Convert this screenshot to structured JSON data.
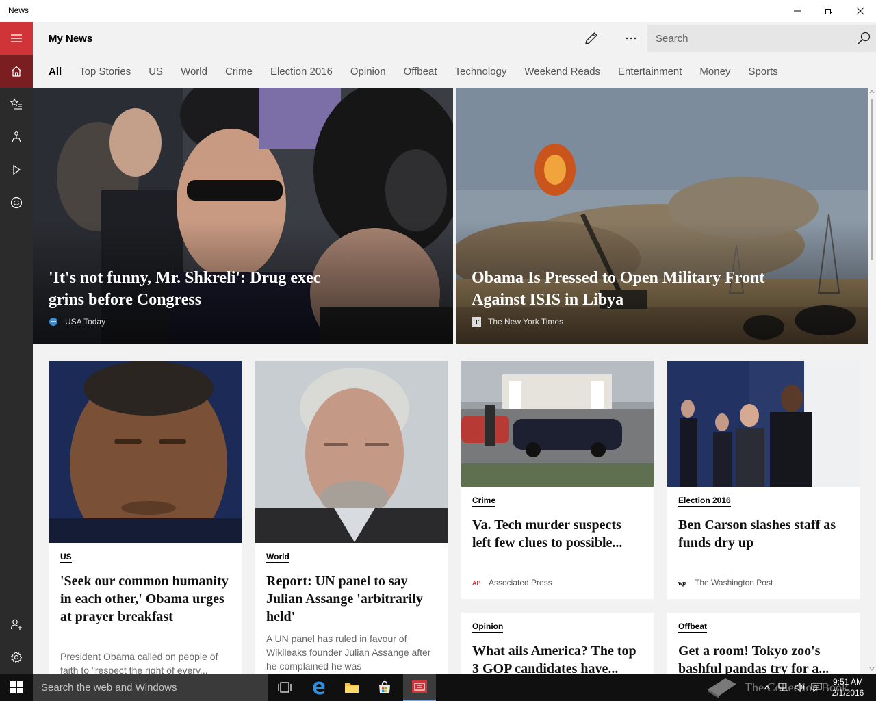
{
  "window": {
    "title": "News",
    "controls": [
      "minimize",
      "restore",
      "close"
    ]
  },
  "rail": {
    "items": [
      {
        "icon": "hamburger-icon",
        "name": "Menu"
      },
      {
        "icon": "home-icon",
        "name": "My News"
      },
      {
        "icon": "star-list-icon",
        "name": "Interests"
      },
      {
        "icon": "local-icon",
        "name": "Local"
      },
      {
        "icon": "play-icon",
        "name": "Video"
      },
      {
        "icon": "smiley-icon",
        "name": "Feedback"
      }
    ],
    "bottom": [
      {
        "icon": "add-person-icon",
        "name": "Sign in"
      },
      {
        "icon": "gear-icon",
        "name": "Settings"
      }
    ]
  },
  "header": {
    "title": "My News",
    "search_placeholder": "Search",
    "tabs": [
      "All",
      "Top Stories",
      "US",
      "World",
      "Crime",
      "Election 2016",
      "Opinion",
      "Offbeat",
      "Technology",
      "Weekend Reads",
      "Entertainment",
      "Money",
      "Sports"
    ],
    "active_tab": "All"
  },
  "hero": [
    {
      "title": "'It's not funny, Mr. Shkreli': Drug exec grins before Congress",
      "source": "USA Today"
    },
    {
      "title": "Obama Is Pressed to Open Military Front Against ISIS in Libya",
      "source": "The New York Times"
    }
  ],
  "cards": [
    {
      "category": "US",
      "title": "'Seek our common humanity in each other,' Obama urges at prayer breakfast",
      "summary": "President Obama called on people of faith to \"respect the right of every..."
    },
    {
      "category": "World",
      "title": "Report: UN panel to say Julian Assange 'arbitrarily held'",
      "summary": "A UN panel has ruled in favour of Wikileaks founder Julian Assange after he complained he was"
    },
    {
      "category": "Crime",
      "title": "Va. Tech murder suspects left few clues to possible...",
      "source": "Associated Press"
    },
    {
      "category": "Election 2016",
      "title": "Ben Carson slashes staff as funds dry up",
      "source": "The Washington Post"
    },
    {
      "category": "Opinion",
      "title": "What ails America? The top 3 GOP candidates have..."
    },
    {
      "category": "Offbeat",
      "title": "Get a room! Tokyo zoo's bashful pandas try for a..."
    }
  ],
  "taskbar": {
    "search_placeholder": "Search the web and Windows",
    "time": "9:51 AM",
    "date": "2/1/2016",
    "watermark": "The Collection Book",
    "apps": [
      "task-view-icon",
      "edge-icon",
      "file-explorer-icon",
      "store-icon",
      "news-app-icon"
    ]
  },
  "colors": {
    "accent": "#d13438",
    "rail_bg": "#2b2b2b",
    "header_bg": "#f2f2f2",
    "taskbar_bg": "#101010"
  }
}
